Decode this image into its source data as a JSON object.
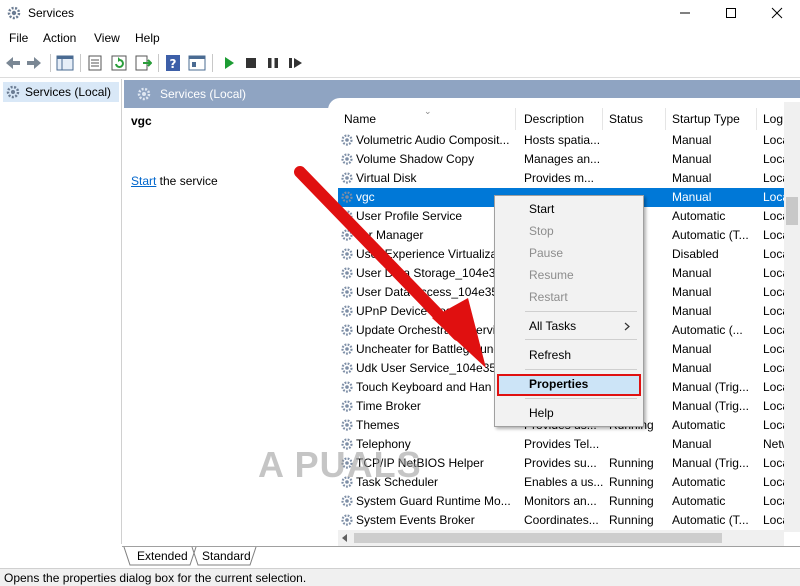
{
  "window": {
    "title": "Services"
  },
  "menubar": {
    "items": [
      "File",
      "Action",
      "View",
      "Help"
    ]
  },
  "tree": {
    "root_label": "Services (Local)"
  },
  "header_band": {
    "label": "Services (Local)"
  },
  "extended": {
    "title": "vgc",
    "link_text": "Start",
    "link_rest": " the service"
  },
  "columns": [
    "Name",
    "Description",
    "Status",
    "Startup Type",
    "Log"
  ],
  "services": [
    {
      "name": "Volumetric Audio Composit...",
      "desc": "Hosts spatia...",
      "status": "",
      "startup": "Manual",
      "logon": "Loca"
    },
    {
      "name": "Volume Shadow Copy",
      "desc": "Manages an...",
      "status": "",
      "startup": "Manual",
      "logon": "Loca"
    },
    {
      "name": "Virtual Disk",
      "desc": "Provides m...",
      "status": "",
      "startup": "Manual",
      "logon": "Loca"
    },
    {
      "name": "vgc",
      "desc": "",
      "status": "",
      "startup": "Manual",
      "logon": "Loca"
    },
    {
      "name": "User Profile Service",
      "desc": "",
      "status": "ng",
      "startup": "Automatic",
      "logon": "Loca"
    },
    {
      "name": "ser Manager",
      "desc": "",
      "status": "ng",
      "startup": "Automatic (T...",
      "logon": "Loca"
    },
    {
      "name": "User Experience Virtualiza",
      "desc": "",
      "status": "",
      "startup": "Disabled",
      "logon": "Loca"
    },
    {
      "name": "User Data Storage_104e35",
      "desc": "",
      "status": "",
      "startup": "Manual",
      "logon": "Loca"
    },
    {
      "name": "User Data Access_104e352",
      "desc": "",
      "status": "",
      "startup": "Manual",
      "logon": "Loca"
    },
    {
      "name": "UPnP Device Host",
      "desc": "",
      "status": "",
      "startup": "Manual",
      "logon": "Loca"
    },
    {
      "name": "Update Orchestrator Servi",
      "desc": "",
      "status": "ng",
      "startup": "Automatic (...",
      "logon": "Loca"
    },
    {
      "name": "Uncheater for Battleground",
      "desc": "",
      "status": "",
      "startup": "Manual",
      "logon": "Loca"
    },
    {
      "name": "Udk User Service_104e352",
      "desc": "",
      "status": "",
      "startup": "Manual",
      "logon": "Loca"
    },
    {
      "name": "Touch Keyboard and Han",
      "desc": "",
      "status": "ng",
      "startup": "Manual (Trig...",
      "logon": "Loca"
    },
    {
      "name": "Time Broker",
      "desc": "",
      "status": "ng",
      "startup": "Manual (Trig...",
      "logon": "Loca"
    },
    {
      "name": "Themes",
      "desc": "Provides us...",
      "status": "Running",
      "startup": "Automatic",
      "logon": "Loca"
    },
    {
      "name": "Telephony",
      "desc": "Provides Tel...",
      "status": "",
      "startup": "Manual",
      "logon": "Netw"
    },
    {
      "name": "TCP/IP NetBIOS Helper",
      "desc": "Provides su...",
      "status": "Running",
      "startup": "Manual (Trig...",
      "logon": "Loca"
    },
    {
      "name": "Task Scheduler",
      "desc": "Enables a us...",
      "status": "Running",
      "startup": "Automatic",
      "logon": "Loca"
    },
    {
      "name": "System Guard Runtime Mo...",
      "desc": "Monitors an...",
      "status": "Running",
      "startup": "Automatic",
      "logon": "Loca"
    },
    {
      "name": "System Events Broker",
      "desc": "Coordinates...",
      "status": "Running",
      "startup": "Automatic (T...",
      "logon": "Loca"
    }
  ],
  "context_menu": {
    "start": "Start",
    "stop": "Stop",
    "pause": "Pause",
    "resume": "Resume",
    "restart": "Restart",
    "all_tasks": "All Tasks",
    "refresh": "Refresh",
    "properties": "Properties",
    "help": "Help"
  },
  "tabs": [
    "Extended",
    "Standard"
  ],
  "statusbar": {
    "text": "Opens the properties dialog box for the current selection."
  },
  "watermark": {
    "text": "A  PUALS"
  },
  "colors": {
    "selection": "#0078d7",
    "header_band": "#8fa4c2",
    "arrow": "#e01010"
  }
}
